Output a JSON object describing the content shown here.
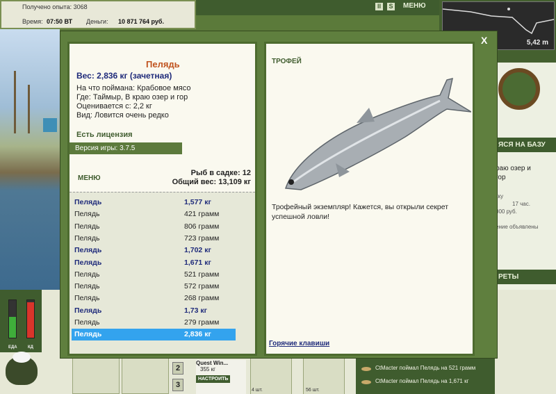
{
  "hud": {
    "exp_label": "Получено опыта: 3068",
    "time_label": "Время:",
    "time_value": "07:50 ВТ",
    "money_label": "Деньги:",
    "money_value": "10 871 764 руб.",
    "menu_label": "МЕНЮ",
    "pause_label": "II",
    "sound_label": "S",
    "depth": "5,42 m"
  },
  "right_panel": {
    "base_band": "ЯСЯ НА БАЗУ",
    "location_line1": "раю озер и",
    "location_line2": "гор",
    "small_lines": [
      "кку",
      "17 час.",
      "000 руб.",
      "ение объявлены"
    ],
    "secrets_band": "РЕТЫ"
  },
  "gauges": {
    "food_label": "ЕДА",
    "energy_label": "КД",
    "food_level": 0.55,
    "energy_level": 0.95
  },
  "bottom": {
    "slot_numbers": [
      "2",
      "3"
    ],
    "quest_title": "Quest Win...",
    "quest_value": "355 кг",
    "quest_button": "НАСТРОИТЬ",
    "hook_count": "4 шт.",
    "bait_count": "56 шт.",
    "feed": [
      "CtMacter поймал Пелядь на 521 грамм",
      "CtMacter поймал Пелядь на 1,671 кг"
    ]
  },
  "modal": {
    "close_label": "X",
    "fish_name": "Пелядь",
    "fish_weight": "Вес: 2,836 кг (зачетная)",
    "bait_line": "На что поймана: Крабовое мясо",
    "where_line": "Где: Таймыр, В краю озер и гор",
    "price_line": "Оценивается с: 2,2 кг",
    "type_line": "Вид: Ловится очень редко",
    "license": "Есть лицензия",
    "version": "Версия игры: 3.7.5",
    "menu_label": "МЕНЮ",
    "keep_count": "Рыб в садке: 12",
    "keep_weight": "Общий вес: 13,109 кг",
    "catches": [
      {
        "name": "Пелядь",
        "weight": "1,577 кг",
        "trophy": true
      },
      {
        "name": "Пелядь",
        "weight": "421 грамм",
        "trophy": false
      },
      {
        "name": "Пелядь",
        "weight": "806 грамм",
        "trophy": false
      },
      {
        "name": "Пелядь",
        "weight": "723 грамм",
        "trophy": false
      },
      {
        "name": "Пелядь",
        "weight": "1,702 кг",
        "trophy": true
      },
      {
        "name": "Пелядь",
        "weight": "1,671 кг",
        "trophy": true
      },
      {
        "name": "Пелядь",
        "weight": "521 грамм",
        "trophy": false
      },
      {
        "name": "Пелядь",
        "weight": "572 грамм",
        "trophy": false
      },
      {
        "name": "Пелядь",
        "weight": "268 грамм",
        "trophy": false
      },
      {
        "name": "Пелядь",
        "weight": "1,73 кг",
        "trophy": true
      },
      {
        "name": "Пелядь",
        "weight": "279 грамм",
        "trophy": false
      },
      {
        "name": "Пелядь",
        "weight": "2,836 кг",
        "trophy": true,
        "selected": true
      }
    ],
    "trophy_title": "ТРОФЕЙ",
    "trophy_text": "Трофейный экземпляр! Кажется, вы открыли секрет успешной ловли!",
    "hotkeys": "Горячие клавиши"
  },
  "colors": {
    "panel_green": "#5f7f3e",
    "trophy_blue": "#1e2a7a",
    "selection": "#33a3ee",
    "fish_name": "#c0531f"
  }
}
